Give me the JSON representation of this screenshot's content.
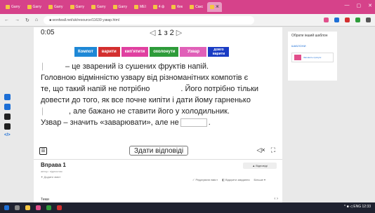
{
  "browser": {
    "tabs": [
      "Garry",
      "Garry",
      "Garry",
      "Garry",
      "Garry",
      "Garry",
      "MEI",
      "4 ф",
      "Кек",
      "Сакс",
      "Ж"
    ],
    "active_tab": "Ж",
    "url": "■ wordwall.net/uk/resource/11639 узвар.html",
    "window_controls": [
      "—",
      "▢",
      "✕"
    ]
  },
  "timer": "0:05",
  "pager": {
    "prev": "◁",
    "current": "1",
    "of": "з",
    "total": "2",
    "next": "▷"
  },
  "word_chips": [
    {
      "label": "Компот",
      "color": "#1e88d6"
    },
    {
      "label": "варити",
      "color": "#d32f2f"
    },
    {
      "label": "кип'ятити",
      "color": "#e040a0"
    },
    {
      "label": "охолонути",
      "color": "#2e9b3a"
    },
    {
      "label": "Узвар",
      "color": "#e060b8"
    },
    {
      "label": "довго варити",
      "color": "#1a3cc4"
    }
  ],
  "passage": {
    "line1_after": " – це зварений із сушених фруктів напій.",
    "line2": "Головною відмінністю узвару від різноманітних компотів є",
    "line3_before": "те, що такий напій не потрібно",
    "line3_after": ". Його потрібно тільки",
    "line4": "довести до того, як все почне кипіти і дати йому гарненько",
    "line5_after": ", але бажано не ставити його у холодильник.",
    "line6_before": "Узвар – значить «заварювати», але не",
    "line6_after": "."
  },
  "controls": {
    "menu_glyph": "☰",
    "submit_label": "Здати відповіді",
    "sound_glyph": "◁×",
    "fullscreen_glyph": "⛶"
  },
  "exercise": {
    "name": "Вправа 1",
    "subtitle": "автор: підписник",
    "meta": "✦ Додати зміст",
    "answers_label": "▲ Відповіді",
    "links": [
      "✓ Редагувати вміст",
      "◧ Відкрити завдання",
      "Більше ▾"
    ]
  },
  "next_card": {
    "title": "Теми",
    "arrows": "‹ ›"
  },
  "sidebar": {
    "heading": "Обрати інший шаблон",
    "sub": "ШАБЛОНИ",
    "thumb_label": "Заповніть пропуск"
  },
  "taskbar": {
    "tray_text": "^ ■ ◁ ENG 12:33"
  }
}
